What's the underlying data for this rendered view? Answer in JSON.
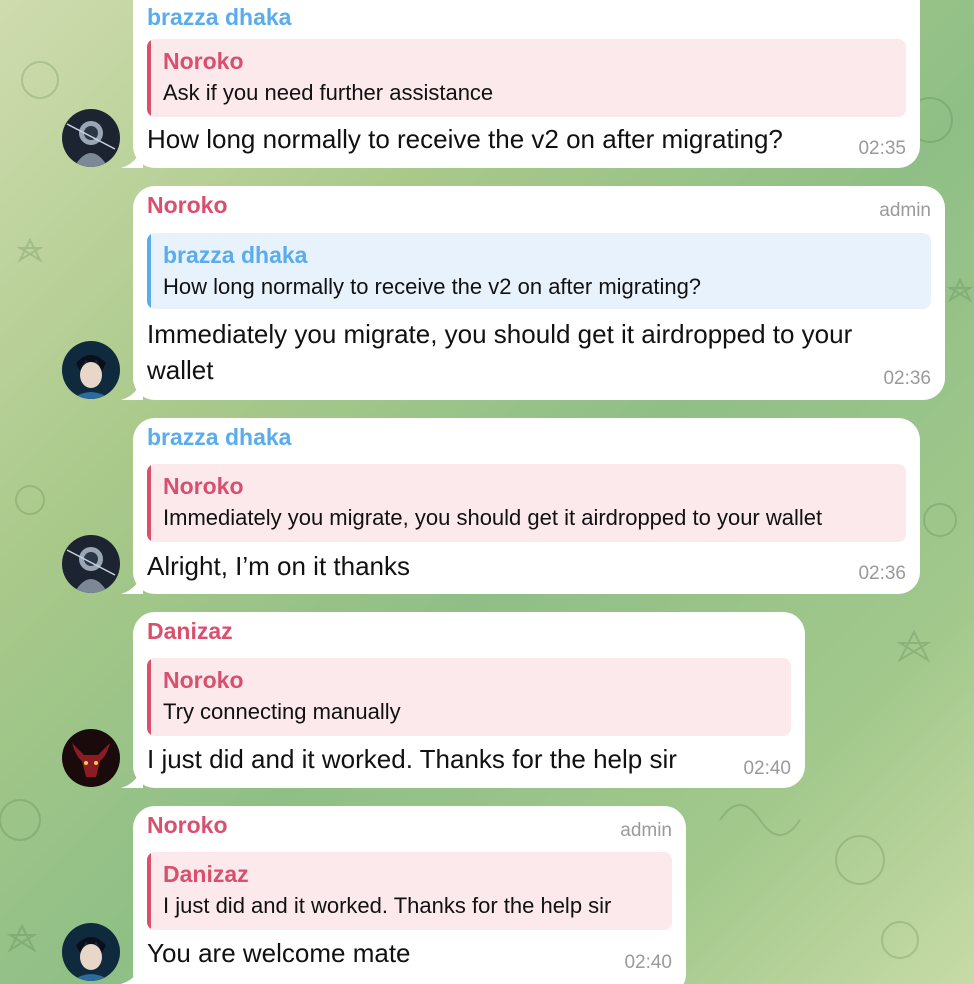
{
  "colors": {
    "noroko": "#d9506f",
    "brazza": "#5aacea",
    "danizaz": "#d9506f",
    "bubble": "#ffffff",
    "meta": "#9a9a9a"
  },
  "messages": [
    {
      "sender": "brazza dhaka",
      "sender_color": "blue",
      "role": "",
      "reply": {
        "name": "Noroko",
        "text": "Ask if you need further assistance"
      },
      "text": "How long normally to receive the v2 on after migrating?",
      "time": "02:35",
      "avatar": "astronaut-avatar"
    },
    {
      "sender": "Noroko",
      "sender_color": "red",
      "role": "admin",
      "reply": {
        "name": "brazza dhaka",
        "text": "How long normally to receive the v2 on after migrating?"
      },
      "text_line1": "Immediately you migrate, you should get it airdropped to your",
      "text_line2": "wallet",
      "time": "02:36",
      "avatar": "anime-boy-avatar"
    },
    {
      "sender": "brazza dhaka",
      "sender_color": "blue",
      "role": "",
      "reply": {
        "name": "Noroko",
        "text": "Immediately you migrate, you should get it airdropped to your wallet"
      },
      "text": "Alright, I’m on it thanks",
      "time": "02:36",
      "avatar": "astronaut-avatar"
    },
    {
      "sender": "Danizaz",
      "sender_color": "red",
      "role": "",
      "reply": {
        "name": "Noroko",
        "text": "Try connecting manually"
      },
      "text": "I just did and it worked. Thanks for the help sir",
      "time": "02:40",
      "avatar": "red-bull-avatar"
    },
    {
      "sender": "Noroko",
      "sender_color": "red",
      "role": "admin",
      "reply": {
        "name": "Danizaz",
        "text": "I just did and it worked. Thanks for the help sir"
      },
      "text": "You are welcome mate",
      "time": "02:40",
      "avatar": "anime-boy-avatar"
    }
  ]
}
